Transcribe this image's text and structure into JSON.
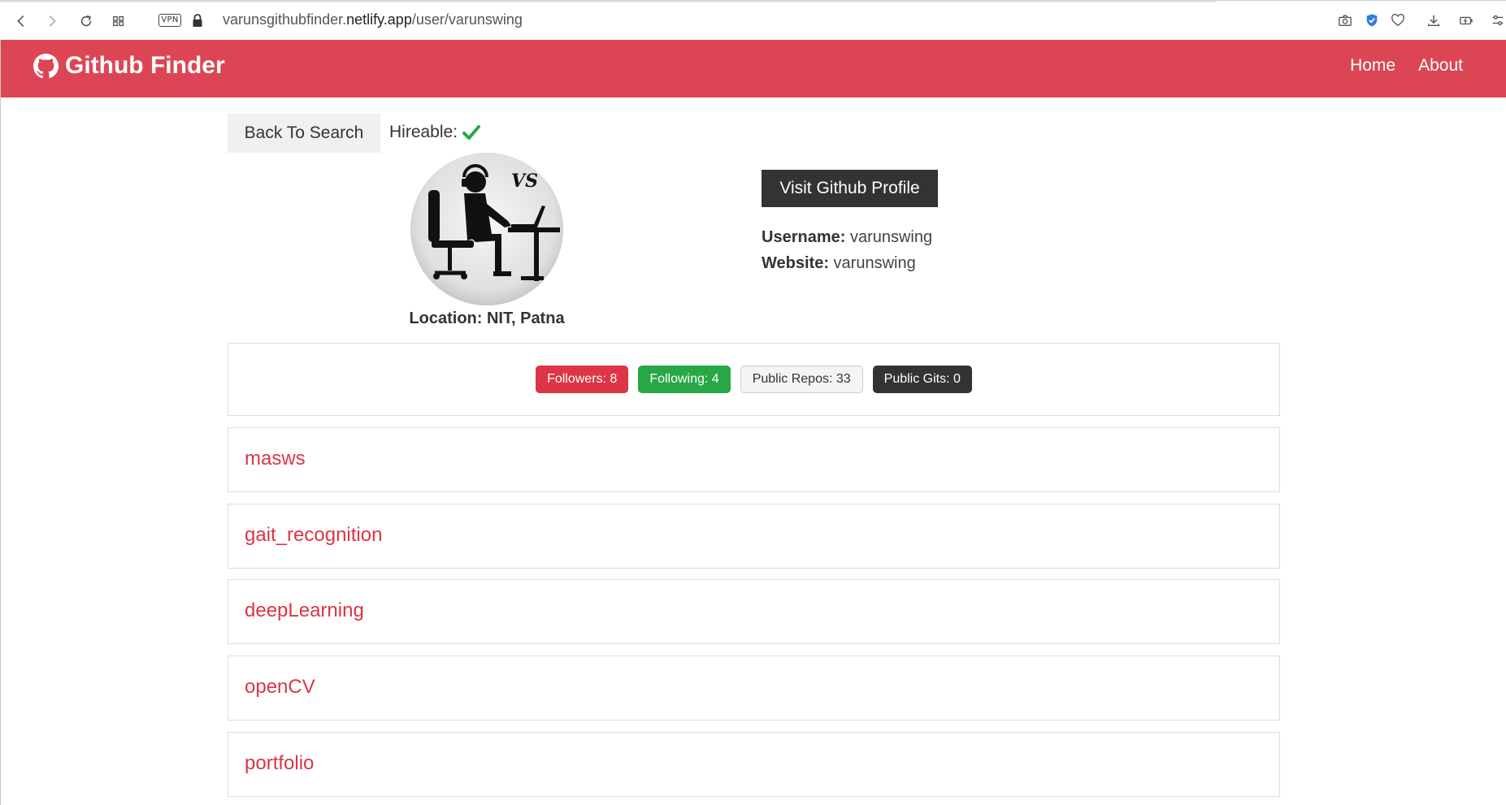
{
  "browser": {
    "vpn_label": "VPN",
    "url_prefix": "varunsgithubfinder.",
    "url_host": "netlify.app",
    "url_path": "/user/varunswing"
  },
  "navbar": {
    "brand": "Github Finder",
    "links": [
      "Home",
      "About"
    ]
  },
  "profile": {
    "back_label": "Back To Search",
    "hireable_label": "Hireable:",
    "hireable": true,
    "location_label": "Location:",
    "location": "NIT, Patna",
    "visit_label": "Visit Github Profile",
    "username_label": "Username:",
    "username": "varunswing",
    "website_label": "Website:",
    "website": "varunswing"
  },
  "stats": {
    "followers": "Followers: 8",
    "following": "Following: 4",
    "public_repos": "Public Repos: 33",
    "public_gists": "Public Gits: 0"
  },
  "repos": [
    "masws",
    "gait_recognition",
    "deepLearning",
    "openCV",
    "portfolio"
  ],
  "colors": {
    "navbar": "#dc4654",
    "danger": "#dc3545",
    "success": "#28a745",
    "dark": "#333333",
    "light": "#f4f4f4"
  }
}
